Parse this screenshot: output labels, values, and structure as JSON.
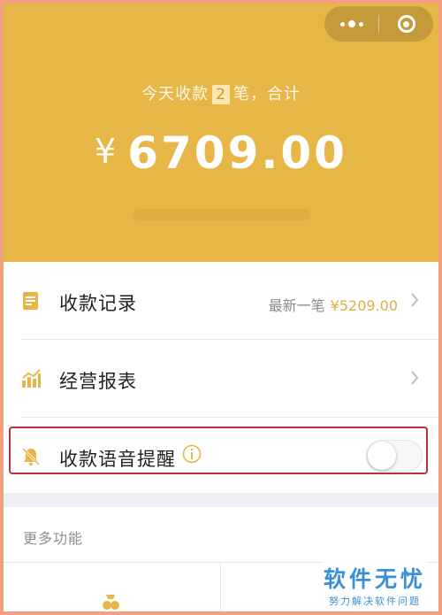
{
  "colors": {
    "brand_yellow": "#e6b647",
    "accent_amount": "#e0ae40",
    "highlight_border": "#b3343c",
    "watermark_blue": "#3a8fd6"
  },
  "capsule": {
    "more_icon": "more-dots-icon",
    "close_icon": "miniprogram-close-icon"
  },
  "summary": {
    "prefix": "今天收款",
    "count": "2",
    "suffix": "笔，合计"
  },
  "amount": {
    "currency": "¥",
    "value": "6709.00"
  },
  "menu": [
    {
      "label": "收款记录",
      "icon": "document-icon",
      "latest_label": "最新一笔",
      "latest_amount": "¥5209.00"
    },
    {
      "label": "经营报表",
      "icon": "bar-chart-icon"
    },
    {
      "label": "收款语音提醒",
      "icon": "bell-off-icon",
      "info_icon": "info-icon",
      "toggle_on": false
    }
  ],
  "more": {
    "title": "更多功能",
    "feature_icon": "people-icon"
  },
  "watermark": {
    "title": "软件无忧",
    "subtitle": "努力解决软件问题"
  }
}
